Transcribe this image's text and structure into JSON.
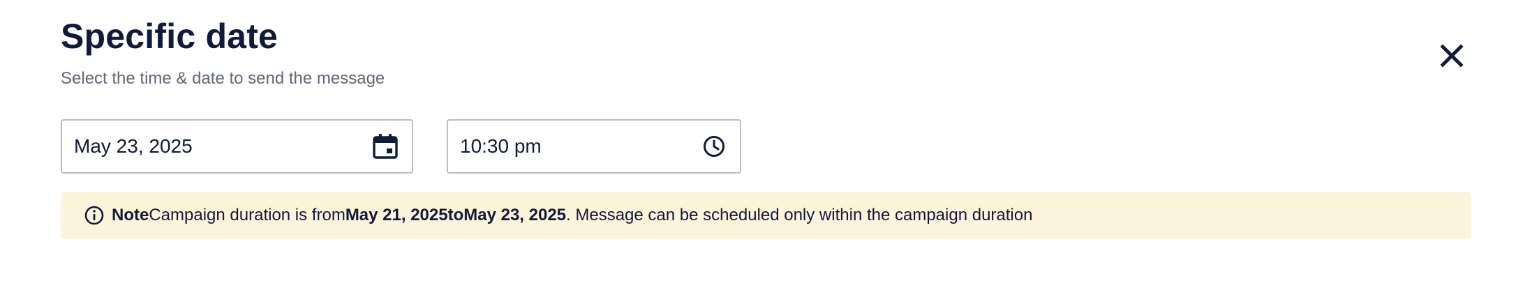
{
  "header": {
    "title": "Specific date",
    "subtitle": "Select the time & date to send the message"
  },
  "close": {
    "icon": "close-icon"
  },
  "date_field": {
    "value": "May 23, 2025",
    "icon": "calendar-icon"
  },
  "time_field": {
    "value": "10:30 pm",
    "icon": "clock-icon"
  },
  "note": {
    "icon": "info-icon",
    "label": "Note",
    "text_before": " Campaign duration is from ",
    "start_date": "May 21, 2025",
    "to_text": "to",
    "end_date": " May 23, 2025",
    "text_after": ". Message can be scheduled only within the campaign duration",
    "background_color": "#fdf4dc"
  },
  "colors": {
    "text_primary": "#101a3a",
    "text_secondary": "#5f6778",
    "field_border": "#b9bdc6"
  }
}
